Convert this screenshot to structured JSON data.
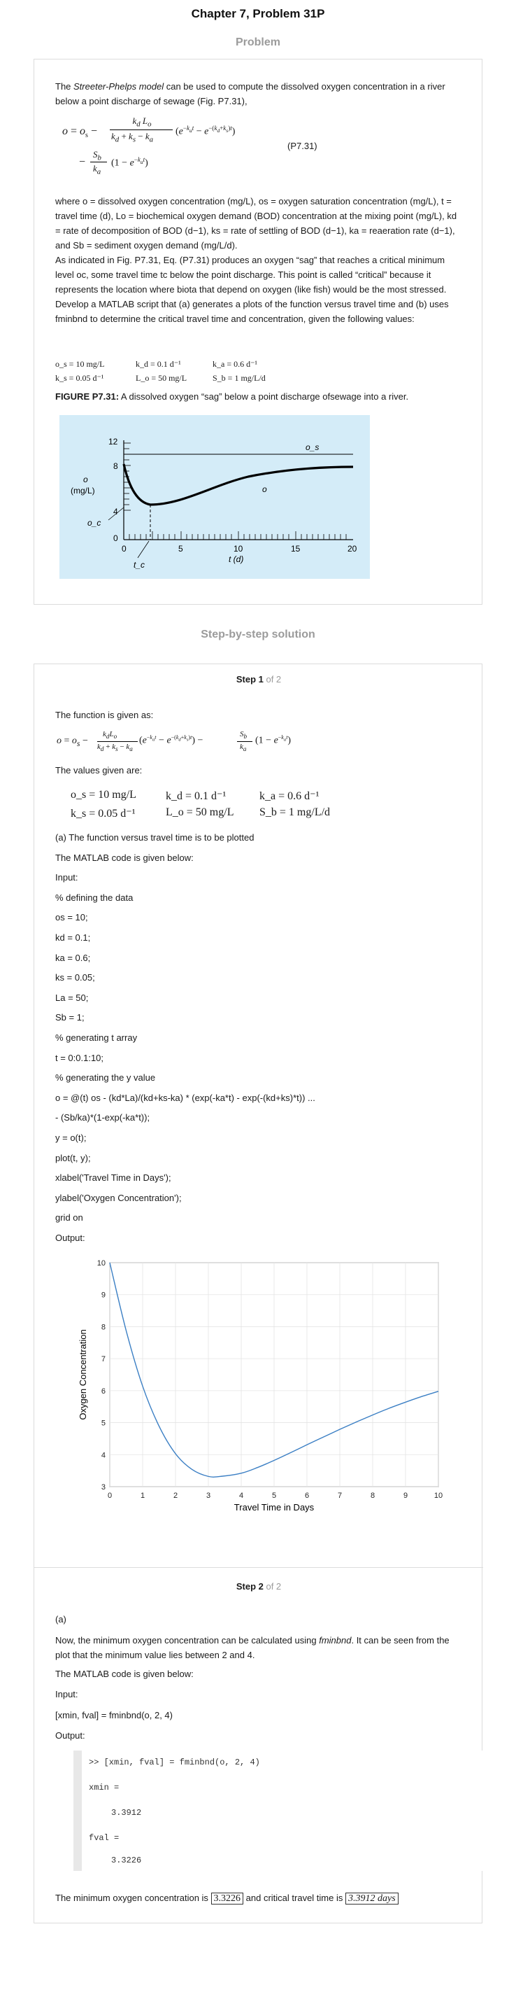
{
  "header": {
    "title": "Chapter 7, Problem 31P",
    "problem_label": "Problem",
    "solution_label": "Step-by-step solution"
  },
  "problem": {
    "intro_pre": "The ",
    "intro_em": "Streeter-Phelps model",
    "intro_post": " can be used to compute the dissolved oxygen concentration in a river below a point discharge of sewage (Fig. P7.31),",
    "eq_number": "(P7.31)",
    "where_text": "where o = dissolved oxygen concentration (mg/L), os = oxygen saturation concentration (mg/L), t = travel time (d), Lo = biochemical oxygen demand (BOD) concentration at the mixing point (mg/L), kd = rate of decomposition of BOD (d−1), ks = rate of settling of BOD (d−1), ka = reaeration rate (d−1), and Sb = sediment oxygen demand (mg/L/d).",
    "task_text": "As indicated in Fig. P7.31, Eq. (P7.31) produces an oxygen “sag” that reaches a critical minimum level oc, some travel time tc below the point discharge. This point is called “critical” because it represents the location where biota that depend on oxygen (like fish) would be the most stressed. Develop a MATLAB script that (a) generates a plots of the function versus travel time and (b) uses fminbnd to determine the critical travel time and concentration, given the following values:",
    "values_row1": [
      "o_s = 10 mg/L",
      "k_d = 0.1 d⁻¹",
      "k_a = 0.6 d⁻¹"
    ],
    "values_row2": [
      "k_s = 0.05 d⁻¹",
      "L_o = 50 mg/L",
      "S_b = 1 mg/L/d"
    ],
    "figure_caption_bold": "FIGURE P7.31:",
    "figure_caption": " A dissolved oxygen “sag” below a point discharge ofsewage into a river.",
    "figure": {
      "ylabel_o": "o",
      "ylabel_unit": "(mg/L)",
      "xlabel": "t (d)",
      "os_label": "o_s",
      "o_label": "o",
      "oc_label": "o_c",
      "tc_label": "t_c",
      "yticks": [
        "12",
        "8",
        "4",
        "0"
      ],
      "xticks": [
        "0",
        "5",
        "10",
        "15",
        "20"
      ]
    }
  },
  "step1": {
    "step_label": "Step 1",
    "of_label": " of 2",
    "intro": "The function is given as:",
    "values_intro": "The values given are:",
    "values_row1": [
      "o_s = 10 mg/L",
      "k_d = 0.1 d⁻¹",
      "k_a = 0.6 d⁻¹"
    ],
    "values_row2": [
      "k_s = 0.05 d⁻¹",
      "L_o = 50 mg/L",
      "S_b = 1 mg/L/d"
    ],
    "lines": [
      "(a) The function versus travel time is to be plotted",
      "The MATLAB code is given below:",
      "Input:",
      "% defining the data",
      "os = 10;",
      "kd = 0.1;",
      "ka = 0.6;",
      "ks = 0.05;",
      "La = 50;",
      "Sb = 1;",
      "% generating t array",
      "t = 0:0.1:10;",
      "% generating the y value",
      "o = @(t) os - (kd*La)/(kd+ks-ka) * (exp(-ka*t) - exp(-(kd+ks)*t)) ...",
      "- (Sb/ka)*(1-exp(-ka*t));",
      "y = o(t);",
      "plot(t, y);",
      "xlabel('Travel Time in Days');",
      "ylabel('Oxygen Concentration');",
      "grid on",
      "Output:"
    ]
  },
  "chart_data": {
    "type": "line",
    "title": "",
    "xlabel": "Travel Time in Days",
    "ylabel": "Oxygen Concentration",
    "xlim": [
      0,
      10
    ],
    "ylim": [
      3,
      10
    ],
    "xticks": [
      0,
      1,
      2,
      3,
      4,
      5,
      6,
      7,
      8,
      9,
      10
    ],
    "yticks": [
      3,
      4,
      5,
      6,
      7,
      8,
      9,
      10
    ],
    "grid": true,
    "series": [
      {
        "color": "#3b7fc4",
        "x": [
          0,
          0.5,
          1,
          1.5,
          2,
          2.5,
          3,
          3.3912,
          4,
          4.5,
          5,
          5.5,
          6,
          6.5,
          7,
          7.5,
          8,
          8.5,
          9,
          9.5,
          10
        ],
        "y": [
          10,
          7.87,
          6.14,
          4.89,
          4.03,
          3.54,
          3.32,
          3.3226,
          3.42,
          3.6,
          3.82,
          4.06,
          4.31,
          4.55,
          4.79,
          5.02,
          5.24,
          5.45,
          5.64,
          5.82,
          5.98
        ]
      }
    ]
  },
  "step2": {
    "step_label": "Step 2",
    "of_label": " of 2",
    "part": "(a)",
    "desc_pre": "Now, the minimum oxygen concentration can be calculated using ",
    "desc_em": "fminbnd",
    "desc_post": ". It can be seen from the plot that the minimum value lies between 2 and 4.",
    "code_intro": "The MATLAB code is given below:",
    "input_label": "Input:",
    "code": "[xmin, fval] = fminbnd(o, 2, 4)",
    "output_label": "Output:",
    "terminal": [
      ">> [xmin, fval] = fminbnd(o, 2, 4)",
      "xmin =",
      "3.3912",
      "fval =",
      "3.3226"
    ],
    "answer_pre": "The minimum oxygen concentration is ",
    "answer_conc": "3.3226",
    "answer_mid": " and critical travel time is ",
    "answer_time": "3.3912 days"
  }
}
